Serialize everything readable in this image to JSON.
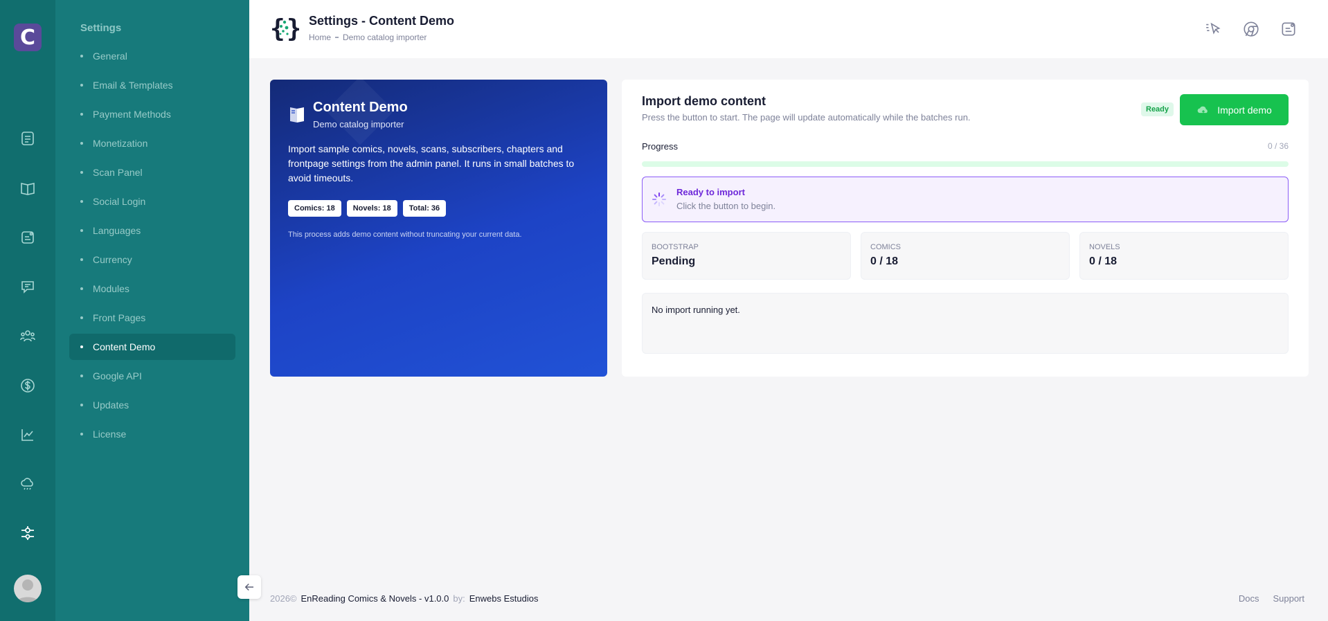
{
  "app": {
    "logo_letter": "C"
  },
  "rail": {
    "icons": [
      "document-icon",
      "book-open-icon",
      "note-icon",
      "message-icon",
      "users-icon",
      "dollar-icon",
      "chart-line-icon",
      "cloud-rain-icon",
      "sliders-icon"
    ]
  },
  "menu": {
    "title": "Settings",
    "items": [
      {
        "label": "General"
      },
      {
        "label": "Email & Templates"
      },
      {
        "label": "Payment Methods"
      },
      {
        "label": "Monetization"
      },
      {
        "label": "Scan Panel"
      },
      {
        "label": "Social Login"
      },
      {
        "label": "Languages"
      },
      {
        "label": "Currency"
      },
      {
        "label": "Modules"
      },
      {
        "label": "Front Pages"
      },
      {
        "label": "Content Demo",
        "active": true
      },
      {
        "label": "Google API"
      },
      {
        "label": "Updates"
      },
      {
        "label": "License"
      }
    ]
  },
  "header": {
    "title": "Settings - Content Demo",
    "breadcrumb": {
      "home": "Home",
      "current": "Demo catalog importer"
    }
  },
  "hero": {
    "title": "Content Demo",
    "subtitle": "Demo catalog importer",
    "description": "Import sample comics, novels, scans, subscribers, chapters and frontpage settings from the admin panel. It runs in small batches to avoid timeouts.",
    "pills": {
      "comics": "Comics: 18",
      "novels": "Novels: 18",
      "total": "Total: 36"
    },
    "note": "This process adds demo content without truncating your current data."
  },
  "import": {
    "title": "Import demo content",
    "description": "Press the button to start. The page will update automatically while the batches run.",
    "status_badge": "Ready",
    "button_label": "Import demo",
    "progress_label": "Progress",
    "progress_count": "0 / 36",
    "progress_fraction": 0,
    "ready_title": "Ready to import",
    "ready_subtitle": "Click the button to begin.",
    "stats": {
      "bootstrap": {
        "label": "Bootstrap",
        "value": "Pending"
      },
      "comics": {
        "label": "Comics",
        "value": "0 / 18"
      },
      "novels": {
        "label": "Novels",
        "value": "0 / 18"
      }
    },
    "log_text": "No import running yet."
  },
  "footer": {
    "year": "2026©",
    "product": "EnReading Comics & Novels - v1.0.0",
    "by": "by:",
    "author": "Enwebs Estudios",
    "links": {
      "docs": "Docs",
      "support": "Support"
    }
  },
  "colors": {
    "rail": "#116e6e",
    "menu": "#177a7b",
    "accent_green": "#17c24f",
    "purple": "#6d28d9"
  }
}
